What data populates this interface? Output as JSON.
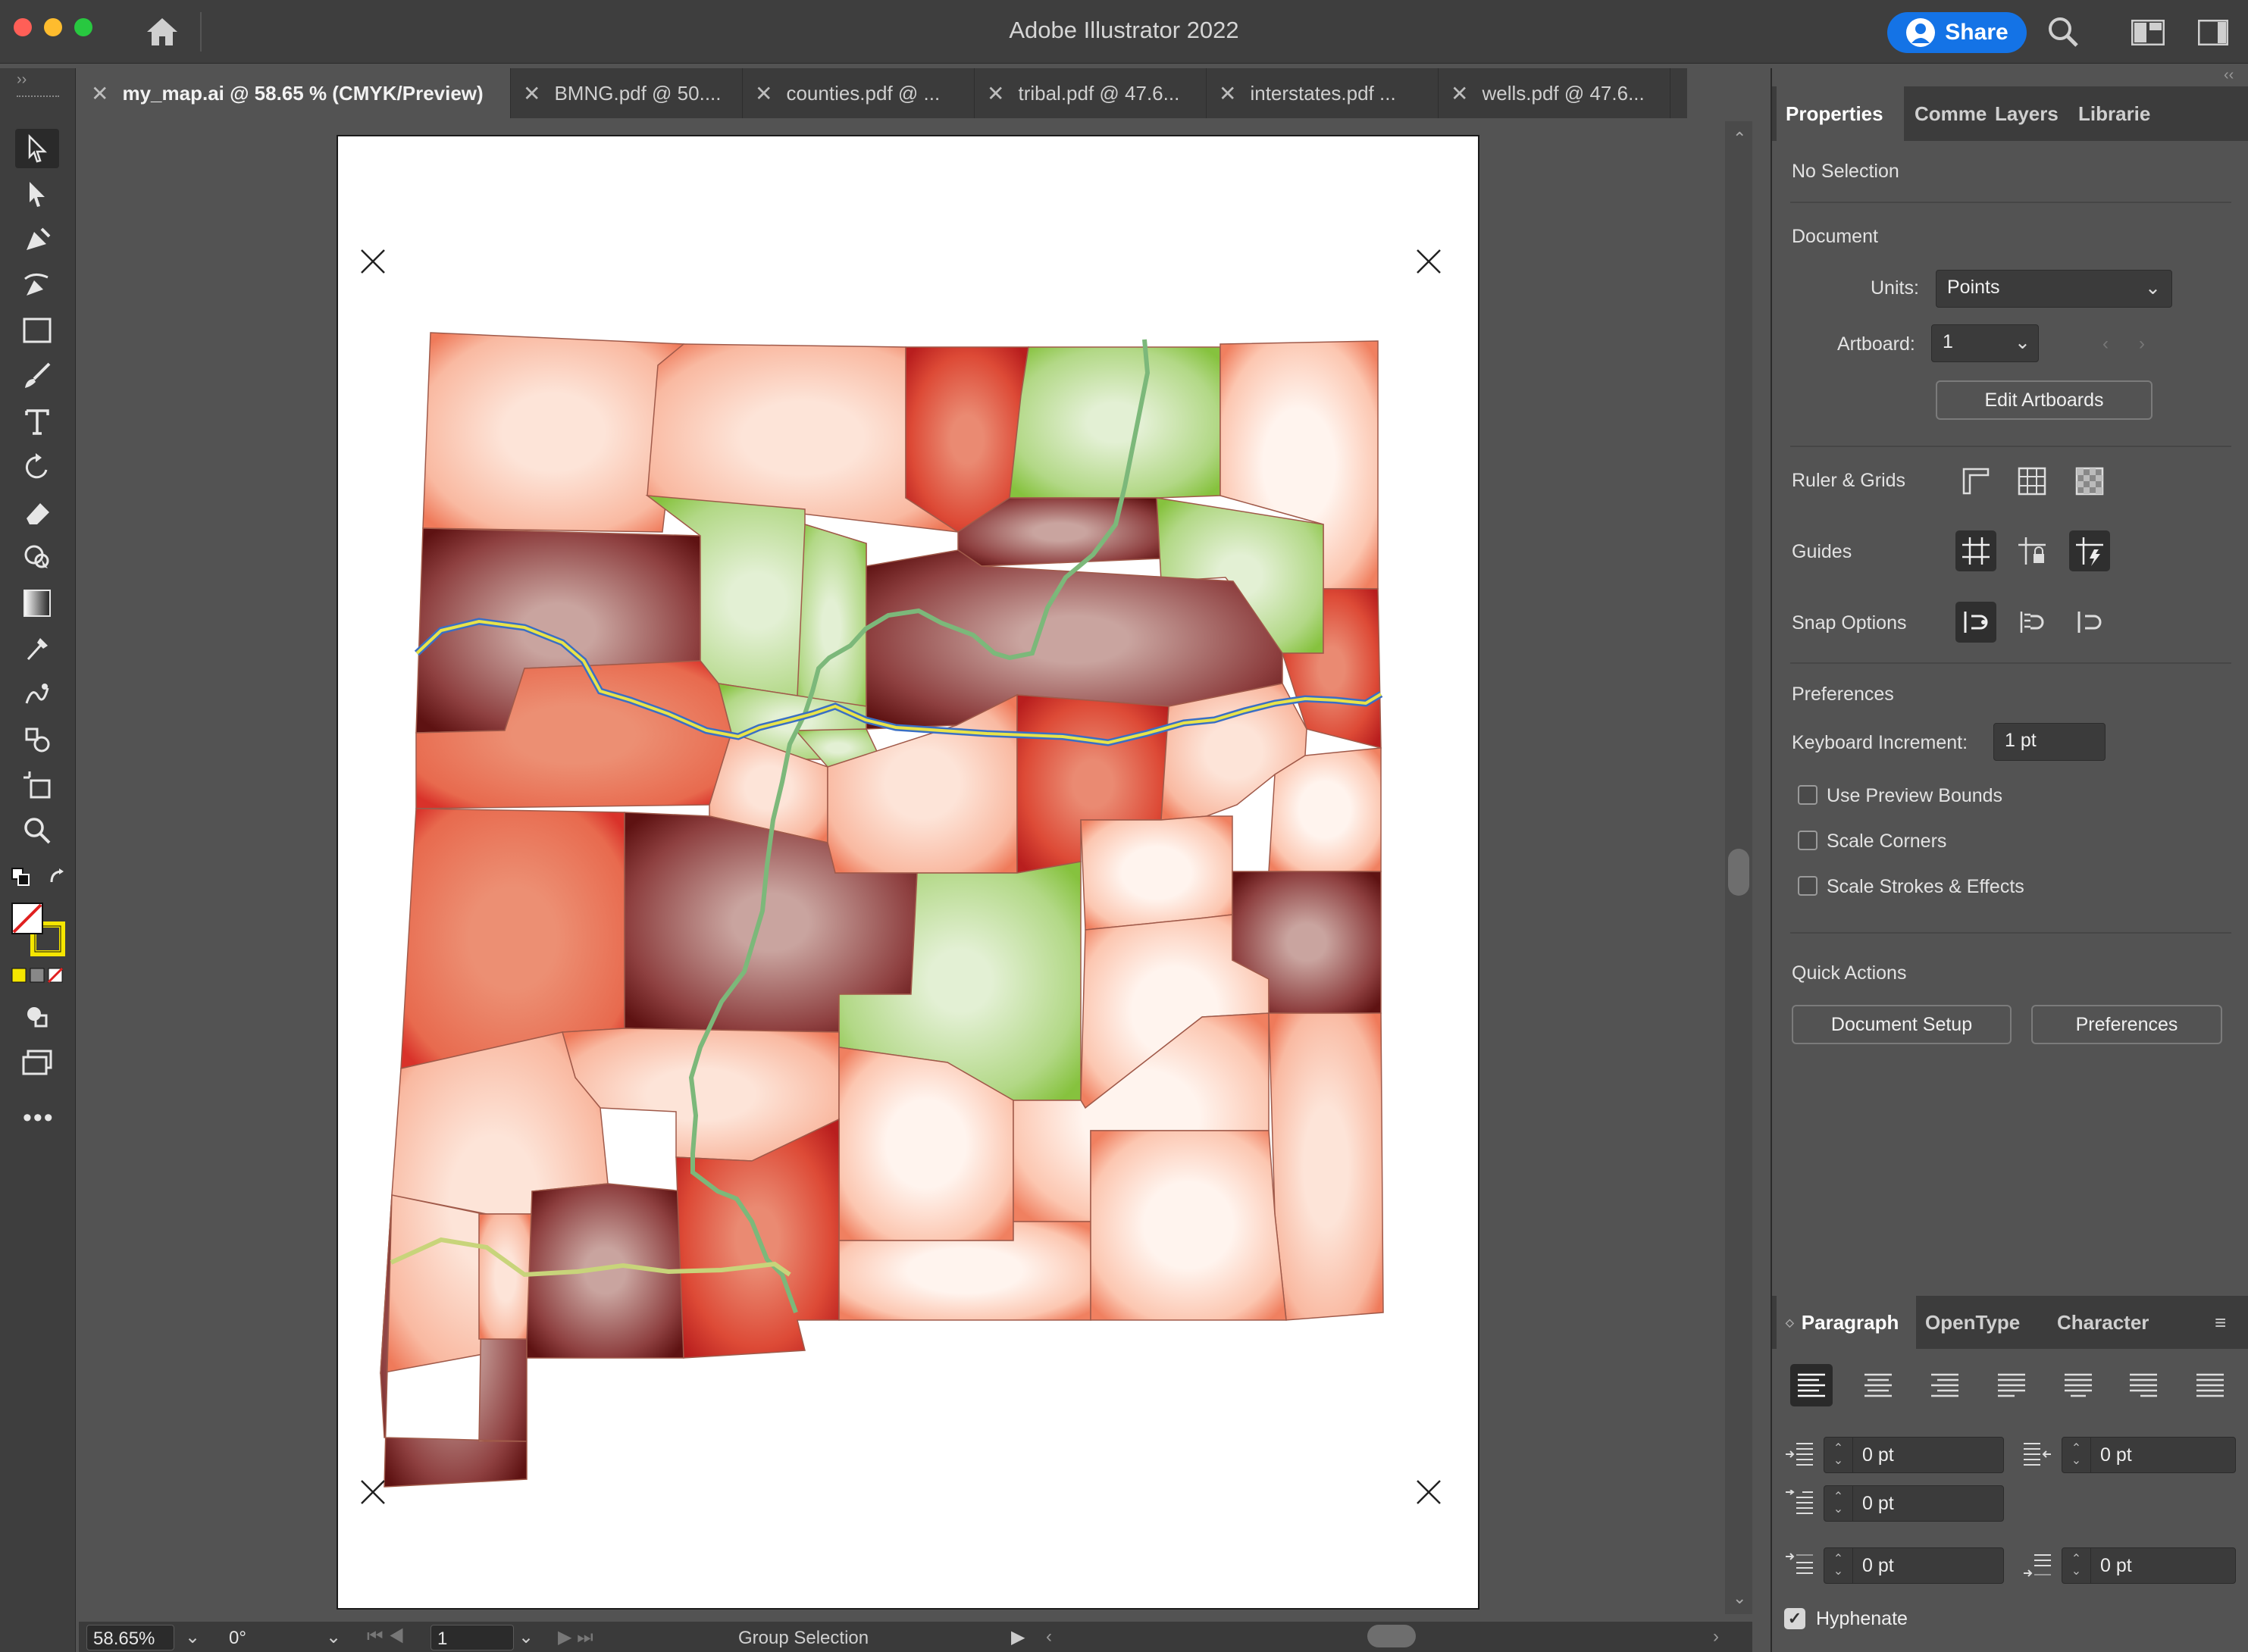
{
  "app": {
    "title": "Adobe Illustrator 2022",
    "share_label": "Share"
  },
  "tabs": [
    {
      "label": "my_map.ai @ 58.65 % (CMYK/Preview)",
      "active": true
    },
    {
      "label": "BMNG.pdf @ 50...."
    },
    {
      "label": "counties.pdf @ ..."
    },
    {
      "label": "tribal.pdf @ 47.6..."
    },
    {
      "label": "interstates.pdf ..."
    },
    {
      "label": "wells.pdf @ 47.6..."
    }
  ],
  "status": {
    "zoom": "58.65%",
    "rotation": "0°",
    "artboard": "1",
    "tool": "Group Selection"
  },
  "panel": {
    "tabs": [
      "Properties",
      "Comme",
      "Layers",
      "Librarie"
    ],
    "selection": "No Selection",
    "document_heading": "Document",
    "units_label": "Units:",
    "units_value": "Points",
    "artboard_label": "Artboard:",
    "artboard_value": "1",
    "edit_artboards": "Edit Artboards",
    "ruler_grids": "Ruler & Grids",
    "guides": "Guides",
    "snap_options": "Snap Options",
    "preferences_heading": "Preferences",
    "keyboard_increment_label": "Keyboard Increment:",
    "keyboard_increment_value": "1 pt",
    "use_preview_bounds": "Use Preview Bounds",
    "scale_corners": "Scale Corners",
    "scale_strokes": "Scale Strokes & Effects",
    "quick_actions": "Quick Actions",
    "document_setup": "Document Setup",
    "preferences_btn": "Preferences"
  },
  "paragraph": {
    "tabs": [
      "Paragraph",
      "OpenType",
      "Character"
    ],
    "left_indent": "0 pt",
    "right_indent": "0 pt",
    "first_line_indent": "0 pt",
    "space_before": "0 pt",
    "space_after": "0 pt",
    "hyphenate": "Hyphenate"
  },
  "colors": {
    "accent": "#1473e6",
    "dark_red": "#6b1a1a",
    "green": "#8cc63f",
    "route": "#7cb87a",
    "interstate": "#e8e34a"
  }
}
